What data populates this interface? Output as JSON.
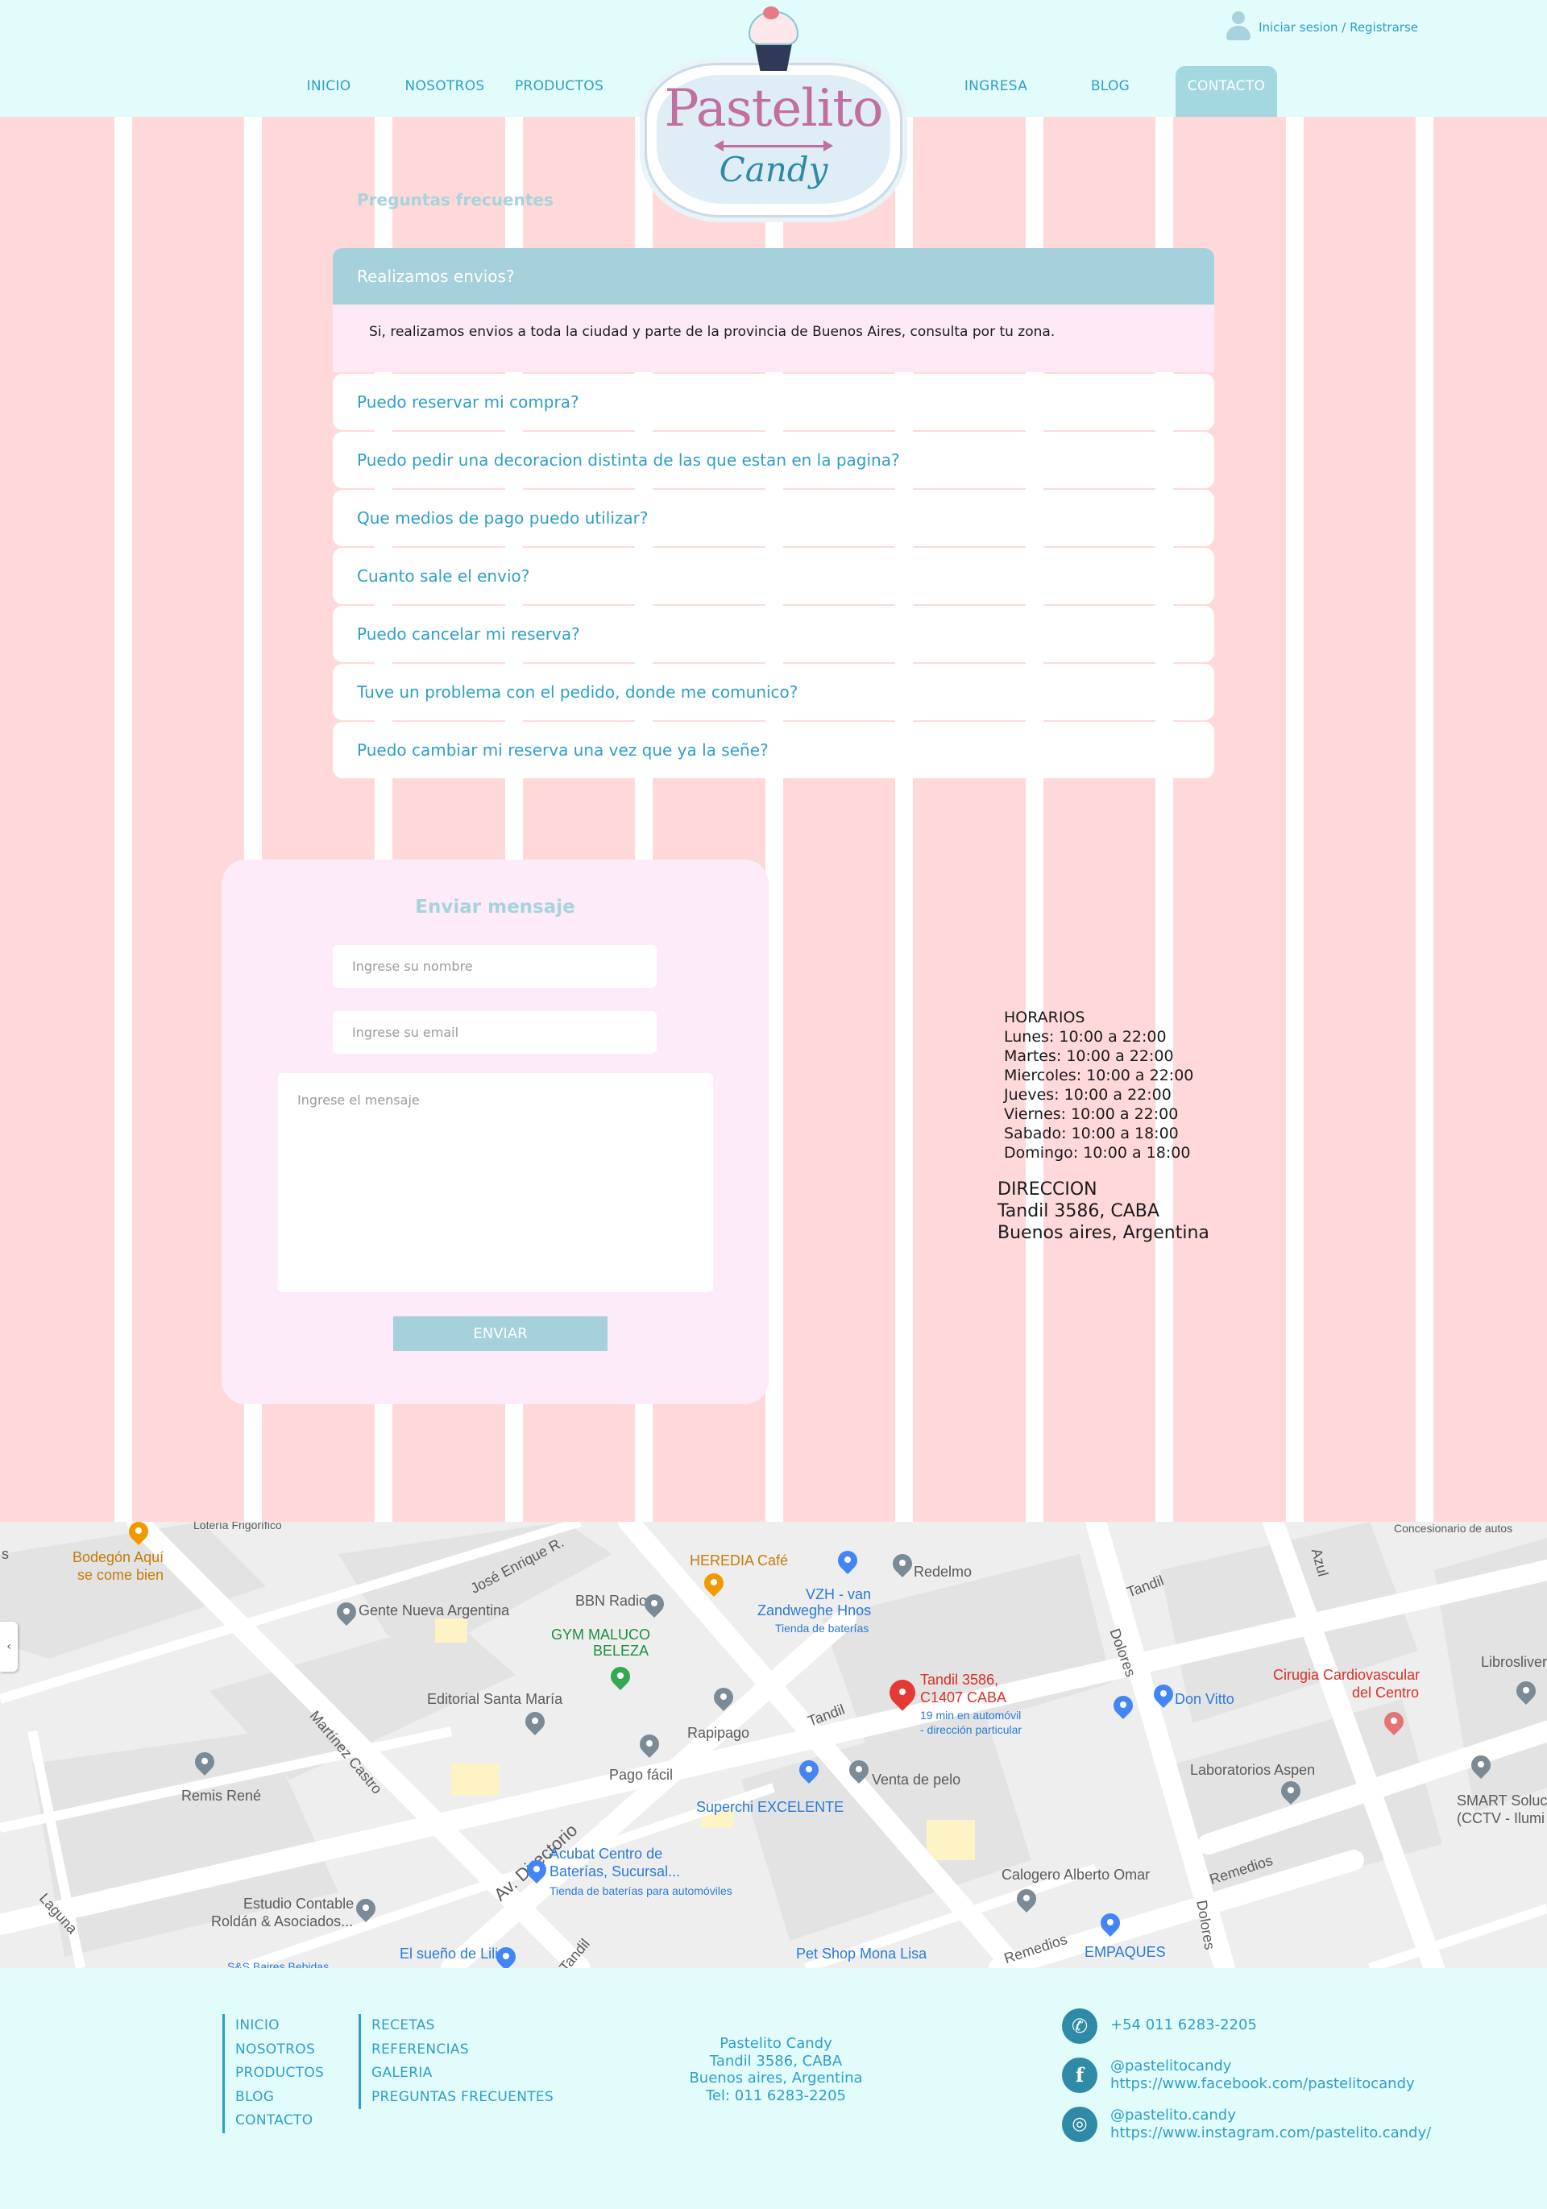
{
  "header": {
    "nav_left": [
      "INICIO",
      "NOSOTROS",
      "PRODUCTOS"
    ],
    "nav_right": [
      "INGRESA",
      "BLOG",
      "CONTACTO"
    ],
    "login": "Iniciar sesion / Registrarse",
    "logo": {
      "title": "Pastelito",
      "subtitle": "Candy"
    }
  },
  "faq": {
    "title": "Preguntas frecuentes",
    "items": [
      {
        "question": "Realizamos envios?",
        "answer": "Si, realizamos envios a toda la ciudad y parte de la provincia de Buenos Aires, consulta por tu zona."
      },
      {
        "question": "Puedo reservar mi compra?"
      },
      {
        "question": "Puedo pedir una decoracion distinta de las que estan en la pagina?"
      },
      {
        "question": "Que medios de pago puedo utilizar?"
      },
      {
        "question": "Cuanto sale el envio?"
      },
      {
        "question": "Puedo cancelar mi reserva?"
      },
      {
        "question": "Tuve un problema con el pedido, donde me comunico?"
      },
      {
        "question": "Puedo cambiar mi reserva una vez que ya la señe?"
      }
    ]
  },
  "form": {
    "title": "Enviar mensaje",
    "name_placeholder": "Ingrese su nombre",
    "email_placeholder": "Ingrese su email",
    "message_placeholder": "Ingrese el mensaje",
    "send_label": "ENVIAR"
  },
  "hours": {
    "title": "HORARIOS",
    "lines": [
      "Lunes: 10:00 a 22:00",
      "Martes: 10:00 a 22:00",
      "Miercoles: 10:00 a 22:00",
      "Jueves: 10:00 a 22:00",
      "Viernes: 10:00 a 22:00",
      "Sabado: 10:00 a 18:00",
      "Domingo: 10:00 a 18:00"
    ]
  },
  "address": {
    "title": "DIRECCION",
    "line1": "Tandil 3586, CABA",
    "line2": "Buenos aires, Argentina"
  },
  "map": {
    "labels": {
      "lotería": "Lotería Frigorífico",
      "bodegon1": "Bodegón Aquí",
      "bodegon2": "se come bien",
      "jose": "José Enrique R.",
      "gente": "Gente Nueva Argentina",
      "bbn": "BBN Radio",
      "heredia": "HEREDIA Café",
      "vzh1": "VZH - van",
      "vzh2": "Zandweghe Hnos",
      "vzh3": "Tienda de baterías",
      "redelmo": "Redelmo",
      "tandil1": "Tandil",
      "gym1": "GYM MALUCO",
      "gym2": "BELEZA",
      "dest1": "Tandil 3586,",
      "dest2": "C1407 CABA",
      "dest3": "19 min en automóvil",
      "dest4": "- dirección particular",
      "dolores1": "Dolores",
      "donvitto": "Don Vitto",
      "cirugia1": "Cirugia Cardiovascular",
      "cirugia2": "del Centro",
      "libros": "Librosliver",
      "concesionario": "Concesionario de autos",
      "azul": "Azul",
      "editorial": "Editorial Santa María",
      "martinez": "Martínez Castro",
      "rapipago": "Rapipago",
      "tandil2": "Tandil",
      "lab": "Laboratorios Aspen",
      "smart1": "SMART Soluci",
      "smart2": "(CCTV - Ilumi",
      "remis": "Remis René",
      "pago": "Pago fácil",
      "venta": "Venta de pelo",
      "superchi": "Superchi EXCELENTE",
      "directorio": "Av. Directorio",
      "acubat1": "Acubat Centro de",
      "acubat2": "Baterías, Sucursal...",
      "acubat3": "Tienda de baterías para automóviles",
      "estudio1": "Estudio Contable",
      "estudio2": "Roldán & Asociados...",
      "calogero": "Calogero Alberto Omar",
      "remedios1": "Remedios",
      "remedios2": "Remedios",
      "dolores2": "Dolores",
      "laguna": "Laguna",
      "sueno": "El sueño de Lili",
      "tandil3": "Tandil",
      "petshop": "Pet Shop Mona Lisa",
      "empaques": "EMPAQUES",
      "sbs": "S&S Baires Bebidas",
      "edge": "s"
    }
  },
  "footer": {
    "col1": [
      "INICIO",
      "NOSOTROS",
      "PRODUCTOS",
      "BLOG",
      "CONTACTO"
    ],
    "col2": [
      "RECETAS",
      "REFERENCIAS",
      "GALERIA",
      "PREGUNTAS FRECUENTES"
    ],
    "center": [
      "Pastelito Candy",
      "Tandil 3586, CABA",
      "Buenos aires, Argentina",
      "Tel: 011 6283-2205"
    ],
    "whatsapp": "+54 011 6283-2205",
    "facebook_handle": "@pastelitocandy",
    "facebook_url": "https://www.facebook.com/pastelitocandy",
    "instagram_handle": "@pastelito.candy",
    "instagram_url": "https://www.instagram.com/pastelito.candy/"
  },
  "colors": {
    "accent": "#2f9fc6",
    "header_bg": "#e2fbfb",
    "stripe_pink": "#ffd9da",
    "active_tab": "#a4d8e1",
    "form_bg": "#fdebfa"
  }
}
